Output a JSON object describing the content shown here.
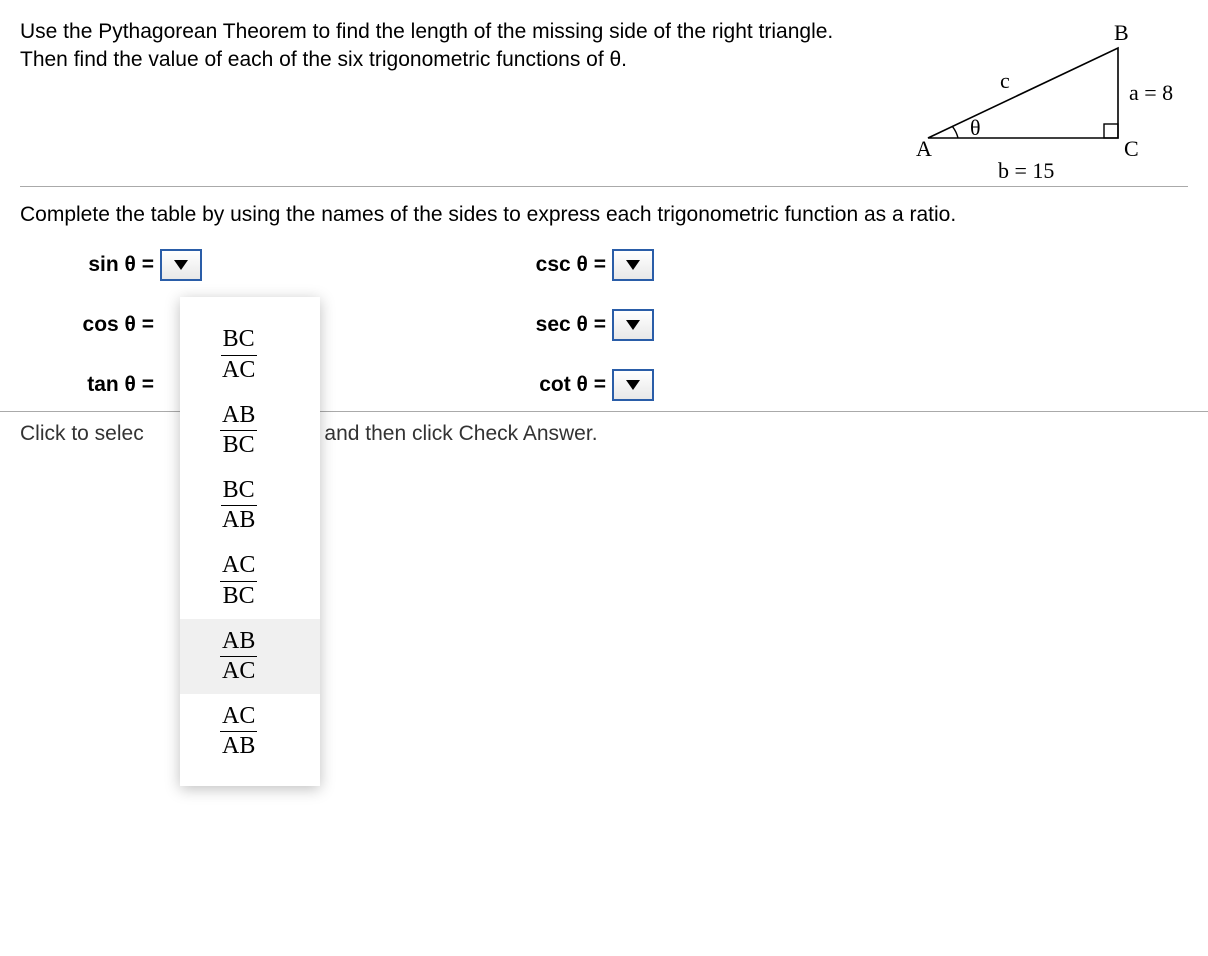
{
  "problem": {
    "text": "Use the Pythagorean Theorem to find the length of the missing side of the right triangle. Then find the value of each of the six trigonometric functions of θ."
  },
  "diagram": {
    "vertexA": "A",
    "vertexB": "B",
    "vertexC": "C",
    "theta": "θ",
    "sideC": "c",
    "sideA": "a = 8",
    "sideB": "b = 15"
  },
  "instruction": "Complete the table by using the names of the sides to express each trigonometric function as a ratio.",
  "labels": {
    "sin": "sin θ =",
    "cos": "cos θ =",
    "tan": "tan θ =",
    "csc": "csc θ =",
    "sec": "sec θ =",
    "cot": "cot θ ="
  },
  "dropdown_options": [
    {
      "num": "BC",
      "den": "AC"
    },
    {
      "num": "AB",
      "den": "BC"
    },
    {
      "num": "BC",
      "den": "AB"
    },
    {
      "num": "AC",
      "den": "BC"
    },
    {
      "num": "AB",
      "den": "AC"
    },
    {
      "num": "AC",
      "den": "AB"
    }
  ],
  "footer": {
    "prefix": "Click to selec",
    "suffix": "er(s) and then click Check Answer."
  }
}
